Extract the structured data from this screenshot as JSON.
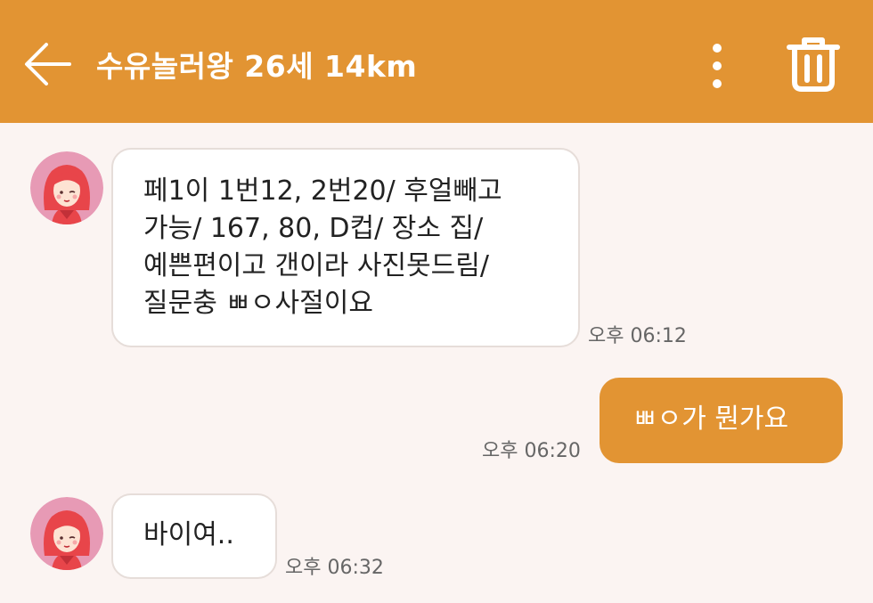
{
  "header": {
    "title": "수유놀러왕 26세 14km",
    "back_icon": "back-arrow-icon",
    "more_icon": "more-vertical-icon",
    "delete_icon": "trash-icon"
  },
  "messages": [
    {
      "direction": "incoming",
      "lines": [
        "페1이 1번12, 2번20/ 후얼빼고",
        "가능/ 167, 80, D컵/ 장소 집/",
        "예쁜편이고 갠이라 사진못드림/",
        "질문충 ㅃㅇ사절이요"
      ],
      "time": "오후 06:12"
    },
    {
      "direction": "outgoing",
      "lines": [
        "ㅃㅇ가 뭔가요"
      ],
      "time": "오후 06:20"
    },
    {
      "direction": "incoming",
      "lines": [
        "바이여.."
      ],
      "time": "오후 06:32"
    }
  ],
  "colors": {
    "accent": "#e29433",
    "background": "#fbf4f2",
    "incoming_bubble": "#ffffff",
    "avatar_bg": "#e79ab5",
    "avatar_hair": "#e8454a"
  }
}
